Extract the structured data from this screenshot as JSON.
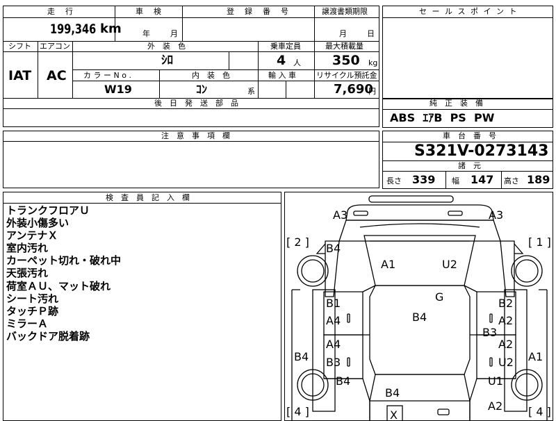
{
  "top_headers": {
    "mileage": "走　行",
    "inspection": "車　検",
    "registration": "登　録　番　号",
    "transfer": "譲渡書類期限"
  },
  "mileage": {
    "value": "199,346",
    "unit": "km"
  },
  "inspection": {
    "year_unit": "年",
    "month_unit": "月"
  },
  "transfer": {
    "month_unit": "月",
    "day_unit": "日"
  },
  "labels": {
    "shift": "シフト",
    "aircon": "エアコン",
    "exterior_color": "外　装　色",
    "capacity": "乗車定員",
    "max_load": "最大積載量",
    "color_no": "カ ラ ー N o .",
    "interior_color": "内　装　色",
    "import": "輸 入 車",
    "recycle": "リサイクル預託金",
    "after_parts": "後　日　発　送　部　品",
    "notes": "注　意　事　項　欄",
    "inspector_notes": "検　査　員　記　入　欄"
  },
  "values": {
    "shift": "IAT",
    "aircon": "AC",
    "exterior_color": "ｼﾛ",
    "capacity": "4",
    "capacity_unit": "人",
    "max_load": "350",
    "max_load_unit": "kg",
    "color_no": "W19",
    "interior_color": "ｺﾝ",
    "interior_color_suffix": "系",
    "recycle": "7,690",
    "recycle_unit": "円"
  },
  "sales_point": {
    "title": "セ ー ル ス ポ イ ン ト"
  },
  "equipment": {
    "title": "純　正　装　備",
    "items": "ABS  ｴｱB  PS  PW"
  },
  "chassis": {
    "title": "車　台　番　号",
    "number": "S321V-0273143"
  },
  "specs": {
    "title": "諸　元",
    "length_label": "長さ",
    "length": "339",
    "width_label": "幅",
    "width": "147",
    "height_label": "高さ",
    "height": "189"
  },
  "inspector_notes": [
    "トランクフロアＵ",
    "外装小傷多い",
    "アンテナＸ",
    "室内汚れ",
    "カーペット切れ・破れ中",
    "天張汚れ",
    "荷室ＡＵ、マット破れ",
    "シート汚れ",
    "タッチＰ跡",
    "ミラーＡ",
    "バックドア脱着跡"
  ],
  "diagram": {
    "corner_labels": [
      "[ 2 ]",
      "[ 1 ]",
      "[ 4 ]",
      "[ 4 ]"
    ],
    "marks": [
      "A3",
      "A3",
      "B4",
      "A1",
      "U2",
      "G",
      "B1",
      "B2",
      "A4",
      "B4",
      "A2",
      "B3",
      "A4",
      "A2",
      "B4",
      "B3",
      "U2",
      "A1",
      "B4",
      "U1",
      "B4",
      "A2",
      "X"
    ]
  }
}
